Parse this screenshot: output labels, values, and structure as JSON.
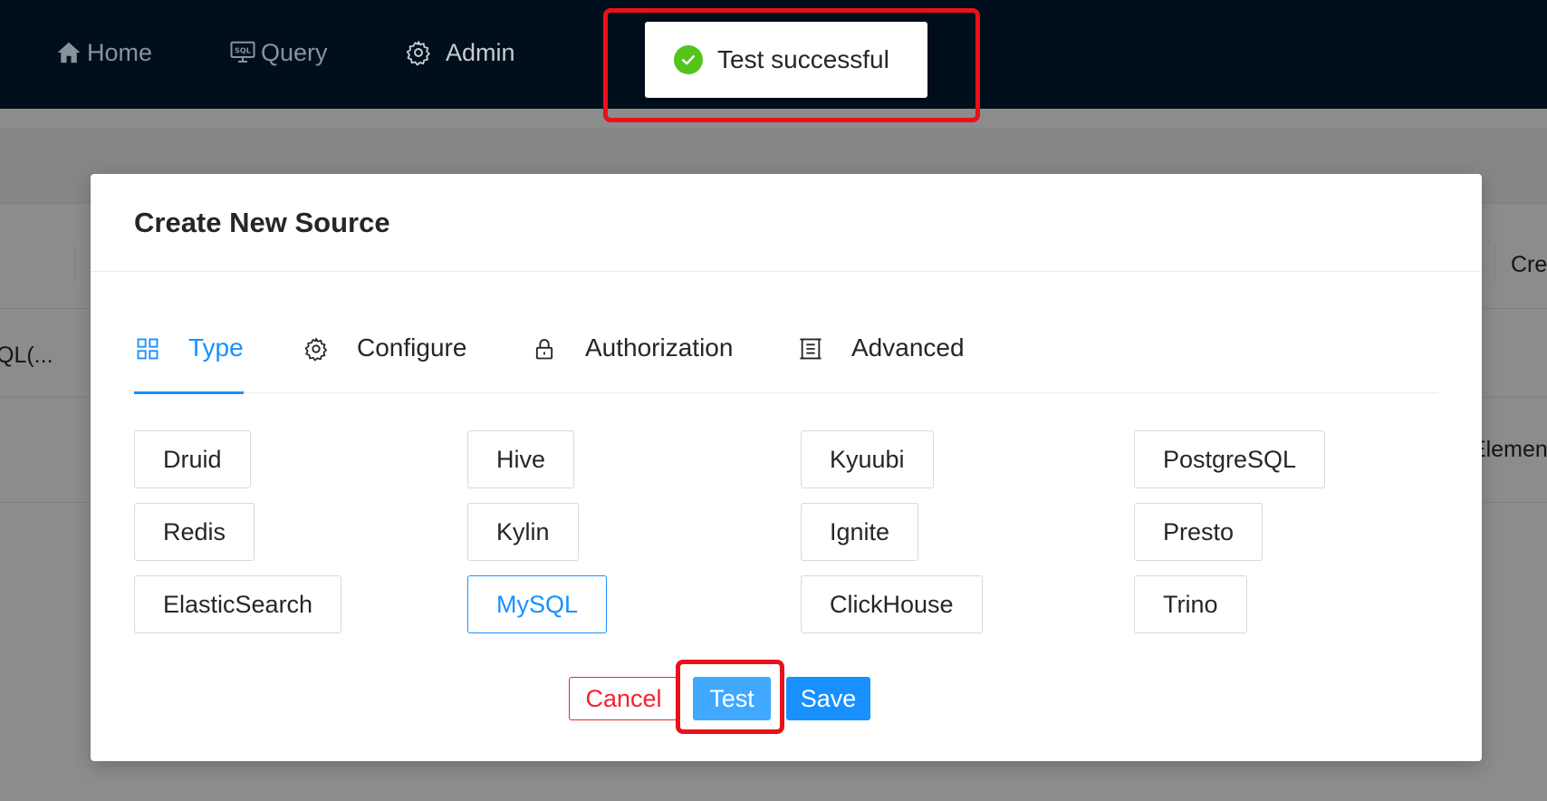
{
  "nav": {
    "items": [
      {
        "label": "Home",
        "icon": "home-icon"
      },
      {
        "label": "Query",
        "icon": "sql-monitor-icon"
      },
      {
        "label": "Admin",
        "icon": "gear-icon"
      }
    ]
  },
  "background": {
    "header_partial": "Cre",
    "row1_partial": "QL(...",
    "row2_partial": "Elemen"
  },
  "toast": {
    "message": "Test successful",
    "icon": "check-circle-icon",
    "color": "#52c41a"
  },
  "modal": {
    "title": "Create New Source",
    "steps": [
      {
        "label": "Type",
        "icon": "grid-icon",
        "active": true
      },
      {
        "label": "Configure",
        "icon": "gear-icon",
        "active": false
      },
      {
        "label": "Authorization",
        "icon": "lock-icon",
        "active": false
      },
      {
        "label": "Advanced",
        "icon": "advanced-icon",
        "active": false
      }
    ],
    "types": [
      "Druid",
      "Hive",
      "Kyuubi",
      "PostgreSQL",
      "Redis",
      "Kylin",
      "Ignite",
      "Presto",
      "ElasticSearch",
      "MySQL",
      "ClickHouse",
      "Trino"
    ],
    "selected_type": "MySQL",
    "buttons": {
      "cancel": "Cancel",
      "test": "Test",
      "save": "Save"
    }
  },
  "colors": {
    "nav_bg": "#010e1c",
    "primary": "#1890ff",
    "danger": "#f5222d",
    "highlight": "#e8111a"
  }
}
